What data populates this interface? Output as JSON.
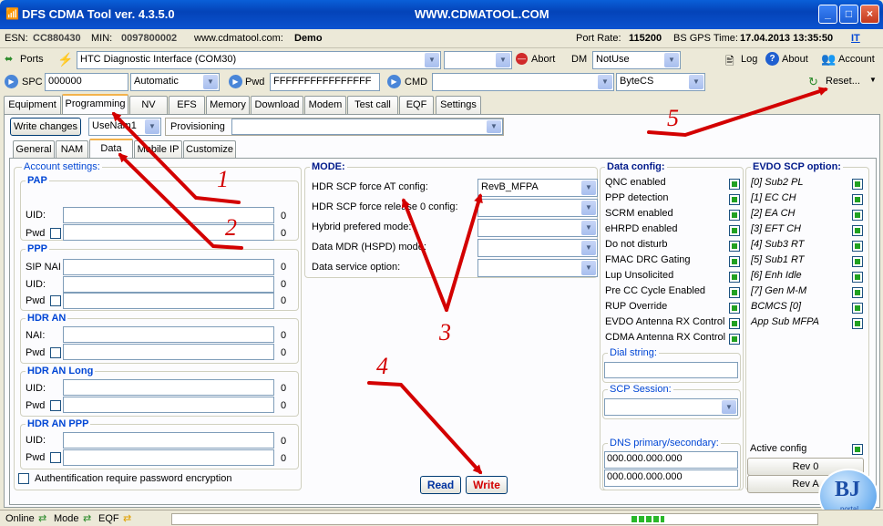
{
  "window": {
    "title": "DFS CDMA Tool ver. 4.3.5.0",
    "url": "WWW.CDMATOOL.COM"
  },
  "info": {
    "esn_label": "ESN:",
    "esn": "CC880430",
    "min_label": "MIN:",
    "min": "0097800002",
    "site": "www.cdmatool.com:",
    "mode": "Demo",
    "port_rate_label": "Port Rate:",
    "port_rate": "115200",
    "bs_gps_label": "BS GPS Time:",
    "bs_gps": "17.04.2013 13:35:50",
    "lang": "IT"
  },
  "toolbar": {
    "ports": "Ports",
    "port_value": "HTC Diagnostic Interface (COM30)",
    "abort": "Abort",
    "dm_label": "DM",
    "dm_value": "NotUse",
    "log": "Log",
    "about": "About",
    "account": "Account"
  },
  "row3": {
    "spc_label": "SPC",
    "spc_value": "000000",
    "spc_mode": "Automatic",
    "pwd_label": "Pwd",
    "pwd_value": "FFFFFFFFFFFFFFFF",
    "cmd_label": "CMD",
    "bytecs": "ByteCS",
    "reset": "Reset..."
  },
  "main_tabs": [
    "Equipment",
    "Programming",
    "NV",
    "EFS",
    "Memory",
    "Download",
    "Modem",
    "Test call",
    "EQF",
    "Settings"
  ],
  "nam_row": {
    "write_changes": "Write changes",
    "nam": "UseNam1",
    "provisioning": "Provisioning"
  },
  "sub_tabs": [
    "General",
    "NAM",
    "Data",
    "Mobile IP",
    "Customize"
  ],
  "account": {
    "title": "Account settings:",
    "pap": {
      "title": "PAP",
      "uid": "UID:",
      "pwd": "Pwd",
      "uid_count": "0",
      "pwd_count": "0"
    },
    "ppp": {
      "title": "PPP",
      "sip": "SIP NAI",
      "uid": "UID:",
      "pwd": "Pwd",
      "sip_count": "0",
      "uid_count": "0",
      "pwd_count": "0"
    },
    "hdr_an": {
      "title": "HDR AN",
      "nai": "NAI:",
      "pwd": "Pwd",
      "nai_count": "0",
      "pwd_count": "0"
    },
    "hdr_an_long": {
      "title": "HDR AN Long",
      "uid": "UID:",
      "pwd": "Pwd",
      "uid_count": "0",
      "pwd_count": "0"
    },
    "hdr_an_ppp": {
      "title": "HDR AN PPP",
      "uid": "UID:",
      "pwd": "Pwd",
      "uid_count": "0",
      "pwd_count": "0"
    },
    "auth": "Authentification require password encryption"
  },
  "mode": {
    "title": "MODE:",
    "rows": [
      {
        "label": "HDR SCP force AT config:",
        "value": "RevB_MFPA"
      },
      {
        "label": "HDR SCP force release 0 config:",
        "value": ""
      },
      {
        "label": "Hybrid prefered mode:",
        "value": ""
      },
      {
        "label": "Data MDR (HSPD) mode:",
        "value": ""
      },
      {
        "label": "Data service option:",
        "value": ""
      }
    ]
  },
  "data_config": {
    "title": "Data config:",
    "items": [
      "QNC enabled",
      "PPP detection",
      "SCRM enabled",
      "eHRPD enabled",
      "Do not disturb",
      "FMAC DRC Gating",
      "Lup Unsolicited",
      "Pre CC Cycle Enabled",
      "RUP Override",
      "EVDO Antenna RX Control",
      "CDMA Antenna RX Control"
    ],
    "dial_label": "Dial string:",
    "scp_label": "SCP Session:",
    "dns_label": "DNS primary/secondary:",
    "dns1": "000.000.000.000",
    "dns2": "000.000.000.000"
  },
  "evdo": {
    "title": "EVDO SCP option:",
    "items": [
      "[0] Sub2 PL",
      "[1] EC CH",
      "[2] EA CH",
      "[3] EFT CH",
      "[4] Sub3 RT",
      "[5] Sub1 RT",
      "[6] Enh Idle",
      "[7] Gen M-M",
      "BCMCS [0]",
      "App Sub MFPA"
    ],
    "active_config": "Active config",
    "rev0": "Rev 0",
    "reva": "Rev A"
  },
  "actions": {
    "read": "Read",
    "write": "Write"
  },
  "annotations": [
    "1",
    "2",
    "3",
    "4",
    "5"
  ],
  "status": {
    "online": "Online",
    "mode": "Mode",
    "eqf": "EQF"
  },
  "watermark": "BJ",
  "watermark_sub": "portal",
  "colors": {
    "title_bar": "#0a5fd8",
    "arrow": "#d30000",
    "group_title": "#0046d5",
    "check_green": "#21a121"
  }
}
